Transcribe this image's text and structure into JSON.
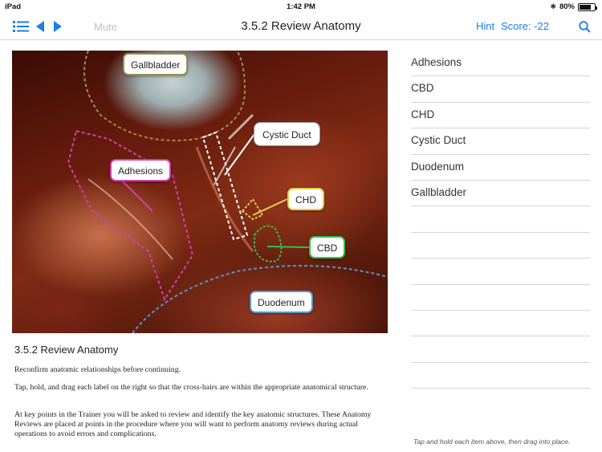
{
  "status_bar": {
    "device": "iPad",
    "time": "1:42 PM",
    "battery_percent": "80%",
    "battery_level": 0.8
  },
  "toolbar": {
    "mute_label": "Mute",
    "title": "3.5.2 Review Anatomy",
    "hint_label": "Hint",
    "score_text": "Score: -22",
    "icons": [
      "list-icon",
      "back-arrow-icon",
      "forward-arrow-icon",
      "search-icon"
    ],
    "accent_color": "#1a7cf0"
  },
  "image_labels": {
    "gallbladder": "Gallbladder",
    "cystic_duct": "Cystic Duct",
    "adhesions": "Adhesions",
    "chd": "CHD",
    "cbd": "CBD",
    "duodenum": "Duodenum"
  },
  "label_colors": {
    "gallbladder": "#9b9050",
    "adhesions": "#d33fb2",
    "cystic_duct": "#ffffff",
    "chd": "#e2cf4f",
    "cbd": "#35c04b",
    "duodenum": "#5597c8"
  },
  "caption": {
    "title": "3.5.2 Review Anatomy",
    "paragraphs": [
      "Reconfirm anatomic relationships before continuing.",
      "Tap, hold, and drag each label on the right so that the cross-hairs are within the appropriate anatomical structure.",
      "At key points in the Trainer you will be asked to review and identify the key anatomic structures. These Anatomy Reviews are placed at points in the procedure where you will want to perform anatomy reviews during actual operations to avoid errors and complications."
    ]
  },
  "label_list": {
    "items": [
      "Adhesions",
      "CBD",
      "CHD",
      "Cystic Duct",
      "Duodenum",
      "Gallbladder",
      "",
      "",
      "",
      "",
      "",
      "",
      ""
    ]
  },
  "footnote": "Tap and hold each item above, then drag into place."
}
